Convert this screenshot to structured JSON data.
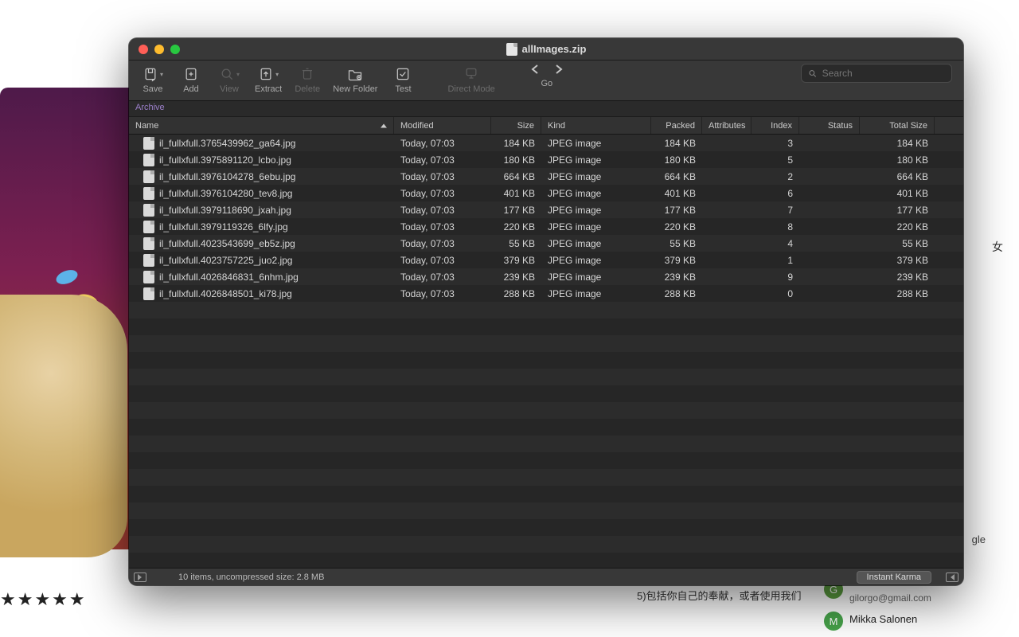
{
  "window": {
    "title": "allImages.zip"
  },
  "toolbar": {
    "save": "Save",
    "add": "Add",
    "view": "View",
    "extract": "Extract",
    "delete": "Delete",
    "new_folder": "New Folder",
    "test": "Test",
    "direct_mode": "Direct Mode",
    "go": "Go"
  },
  "search": {
    "placeholder": "Search"
  },
  "source_label": "Archive",
  "columns": {
    "name": "Name",
    "modified": "Modified",
    "size": "Size",
    "kind": "Kind",
    "packed": "Packed",
    "attributes": "Attributes",
    "index": "Index",
    "status": "Status",
    "total": "Total Size"
  },
  "files": [
    {
      "name": "il_fullxfull.3765439962_ga64.jpg",
      "modified": "Today, 07:03",
      "size": "184 KB",
      "kind": "JPEG image",
      "packed": "184 KB",
      "attr": "",
      "index": "3",
      "status": "",
      "total": "184 KB"
    },
    {
      "name": "il_fullxfull.3975891120_lcbo.jpg",
      "modified": "Today, 07:03",
      "size": "180 KB",
      "kind": "JPEG image",
      "packed": "180 KB",
      "attr": "",
      "index": "5",
      "status": "",
      "total": "180 KB"
    },
    {
      "name": "il_fullxfull.3976104278_6ebu.jpg",
      "modified": "Today, 07:03",
      "size": "664 KB",
      "kind": "JPEG image",
      "packed": "664 KB",
      "attr": "",
      "index": "2",
      "status": "",
      "total": "664 KB"
    },
    {
      "name": "il_fullxfull.3976104280_tev8.jpg",
      "modified": "Today, 07:03",
      "size": "401 KB",
      "kind": "JPEG image",
      "packed": "401 KB",
      "attr": "",
      "index": "6",
      "status": "",
      "total": "401 KB"
    },
    {
      "name": "il_fullxfull.3979118690_jxah.jpg",
      "modified": "Today, 07:03",
      "size": "177 KB",
      "kind": "JPEG image",
      "packed": "177 KB",
      "attr": "",
      "index": "7",
      "status": "",
      "total": "177 KB"
    },
    {
      "name": "il_fullxfull.3979119326_6lfy.jpg",
      "modified": "Today, 07:03",
      "size": "220 KB",
      "kind": "JPEG image",
      "packed": "220 KB",
      "attr": "",
      "index": "8",
      "status": "",
      "total": "220 KB"
    },
    {
      "name": "il_fullxfull.4023543699_eb5z.jpg",
      "modified": "Today, 07:03",
      "size": "55 KB",
      "kind": "JPEG image",
      "packed": "55 KB",
      "attr": "",
      "index": "4",
      "status": "",
      "total": "55 KB"
    },
    {
      "name": "il_fullxfull.4023757225_juo2.jpg",
      "modified": "Today, 07:03",
      "size": "379 KB",
      "kind": "JPEG image",
      "packed": "379 KB",
      "attr": "",
      "index": "1",
      "status": "",
      "total": "379 KB"
    },
    {
      "name": "il_fullxfull.4026846831_6nhm.jpg",
      "modified": "Today, 07:03",
      "size": "239 KB",
      "kind": "JPEG image",
      "packed": "239 KB",
      "attr": "",
      "index": "9",
      "status": "",
      "total": "239 KB"
    },
    {
      "name": "il_fullxfull.4026848501_ki78.jpg",
      "modified": "Today, 07:03",
      "size": "288 KB",
      "kind": "JPEG image",
      "packed": "288 KB",
      "attr": "",
      "index": "0",
      "status": "",
      "total": "288 KB"
    }
  ],
  "status": {
    "summary": "10 items, uncompressed size: 2.8 MB",
    "karma": "Instant Karma"
  },
  "background": {
    "stars": "★★★★★",
    "foot_cn": "5)包括你自己的奉献，或者使用我们",
    "right_cn": "女",
    "right_gle": "gle",
    "avatar_g": "G",
    "avatar_m": "M",
    "email1": "gilorgo@gmail.com",
    "name2": "Mikka Salonen"
  }
}
